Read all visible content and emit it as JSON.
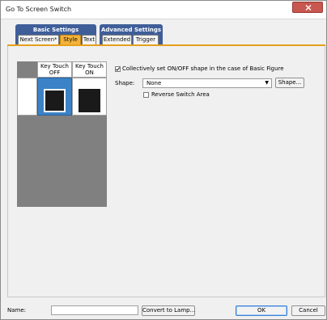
{
  "window": {
    "title": "Go To Screen Switch"
  },
  "tab_groups": [
    {
      "label": "Basic Settings"
    },
    {
      "label": "Advanced Settings"
    }
  ],
  "tabs": [
    {
      "label": "Next Screen*",
      "active": false
    },
    {
      "label": "Style",
      "active": true
    },
    {
      "label": "Text",
      "active": false
    },
    {
      "label": "Extended",
      "active": false
    },
    {
      "label": "Trigger",
      "active": false
    }
  ],
  "preview": {
    "headers": [
      "Key Touch OFF",
      "Key Touch ON"
    ],
    "header_lines": [
      [
        "Key Touch",
        "OFF"
      ],
      [
        "Key Touch",
        "ON"
      ]
    ]
  },
  "style": {
    "collective_label": "Collectively set ON/OFF shape in the case of Basic Figure",
    "collective_checked": true,
    "shape_label": "Shape:",
    "shape_value": "None",
    "shape_button": "Shape...",
    "reverse_label": "Reverse Switch Area",
    "reverse_checked": false
  },
  "footer": {
    "name_label": "Name:",
    "name_value": "",
    "convert_button": "Convert to Lamp...",
    "ok_button": "OK",
    "cancel_button": "Cancel"
  },
  "colors": {
    "group_tab": "#3f5e99",
    "active_tab": "#f4b23a",
    "selected_cell": "#3b82c6",
    "close_button": "#c85750"
  }
}
